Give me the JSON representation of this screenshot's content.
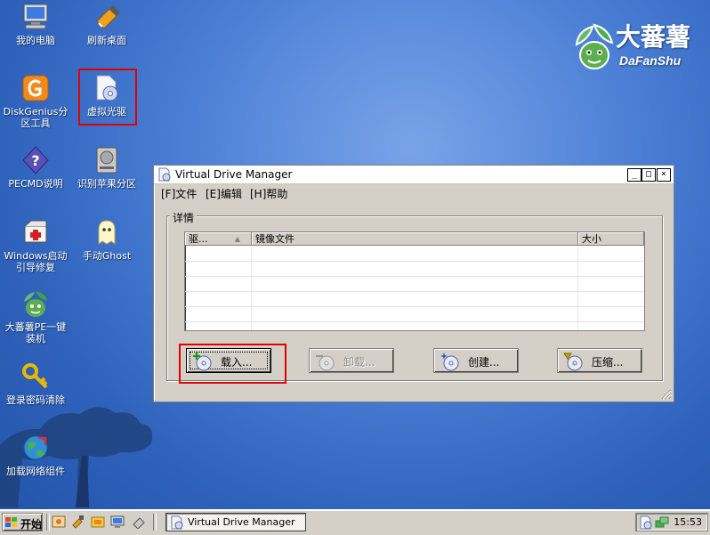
{
  "desktop": {
    "logo": {
      "text_cn": "大蕃薯",
      "text_en": "DaFanShu"
    },
    "icons": [
      {
        "label": "我的电脑",
        "icon": "my-computer-icon"
      },
      {
        "label": "刷新桌面",
        "icon": "refresh-desktop-icon"
      },
      {
        "label": "DiskGenius分\n区工具",
        "label1": "DiskGenius分",
        "label2": "区工具",
        "icon": "diskgenius-icon"
      },
      {
        "label": "虚拟光驱",
        "icon": "virtual-drive-icon"
      },
      {
        "label": "PECMD说明",
        "icon": "help-icon"
      },
      {
        "label": "识别苹果分区",
        "icon": "disk-drive-icon"
      },
      {
        "label1": "Windows启动",
        "label2": "引导修复",
        "icon": "repair-kit-icon"
      },
      {
        "label": "手动Ghost",
        "icon": "ghost-icon"
      },
      {
        "label1": "大蕃薯PE一键",
        "label2": "装机",
        "icon": "dafanshu-mascot-icon"
      },
      {
        "label": "登录密码清除",
        "icon": "key-icon"
      },
      {
        "label": "加载网络组件",
        "icon": "network-globe-icon"
      }
    ]
  },
  "window": {
    "title": "Virtual Drive Manager",
    "controls": {
      "minimize": "_",
      "maximize": "□",
      "close": "×"
    },
    "menu": [
      {
        "label": "[F]文件"
      },
      {
        "label": "[E]编辑"
      },
      {
        "label": "[H]帮助"
      }
    ],
    "group_title": "详情",
    "table": {
      "columns": [
        "驱...",
        "镜像文件",
        "大小"
      ],
      "sort_indicator": "▲",
      "rows": []
    },
    "buttons": [
      {
        "label": "载入...",
        "enabled": true
      },
      {
        "label": "卸载...",
        "enabled": false
      },
      {
        "label": "创建...",
        "enabled": true
      },
      {
        "label": "压缩...",
        "enabled": true
      }
    ]
  },
  "taskbar": {
    "start_label": "开始",
    "task": {
      "label": "Virtual Drive Manager"
    },
    "clock": "15:53"
  },
  "colors": {
    "highlight_box": "#e00000",
    "desktop_blue": "#3a6cc4",
    "window_face": "#d4d0c8"
  }
}
